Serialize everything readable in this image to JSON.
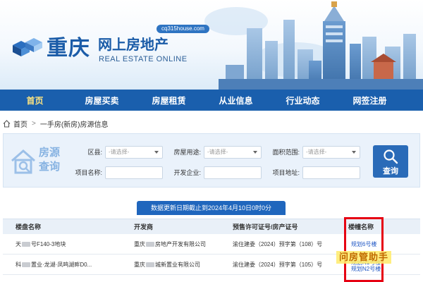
{
  "header": {
    "url_badge": "cq315house.com",
    "title_big": "重庆",
    "title_cn": "网上房地产",
    "title_en": "REAL ESTATE ONLINE"
  },
  "nav": [
    {
      "label": "首页",
      "active": true
    },
    {
      "label": "房屋买卖"
    },
    {
      "label": "房屋租赁"
    },
    {
      "label": "从业信息"
    },
    {
      "label": "行业动态"
    },
    {
      "label": "网签注册"
    }
  ],
  "breadcrumb": {
    "home": "首页",
    "separator": ">",
    "current": "一手房(新房)房源信息"
  },
  "search": {
    "logo_line1": "房源",
    "logo_line2": "查询",
    "district_label": "区县:",
    "district_placeholder": "-请选择-",
    "usage_label": "房屋用途:",
    "usage_placeholder": "-请选择-",
    "area_label": "面积范围:",
    "area_placeholder": "-请选择-",
    "project_name_label": "项目名称:",
    "developer_label": "开发企业:",
    "project_address_label": "项目地址:",
    "button_label": "查询"
  },
  "update_notice": "数据更新日期截止到2024年4月10日0时0分",
  "table": {
    "headers": {
      "project": "楼盘名称",
      "developer": "开发商",
      "license": "预售许可证号/房产证号",
      "building": "楼幢名称"
    },
    "rows": [
      {
        "project_prefix": "天",
        "project_suffix": "号F140-3地块",
        "developer_prefix": "重庆",
        "developer_suffix": "房地产开发有限公司",
        "license": "渝住建委（2024）预字第（108）号",
        "buildings": [
          "规划6号楼"
        ]
      },
      {
        "project_prefix": "科",
        "project_suffix": "置业·龙湖·凤鸣湖畔D0...",
        "developer_prefix": "重庆",
        "developer_suffix": "城新置业有限公司",
        "license": "渝住建委（2024）预字第（105）号",
        "buildings": [
          "规划N1号楼",
          "规划N2号楼"
        ]
      }
    ]
  },
  "watermark": "问房管助手",
  "colors": {
    "nav_bg": "#1a5fad",
    "accent": "#1f66bd",
    "link": "#1f57c5",
    "highlight_border": "#e60012"
  }
}
